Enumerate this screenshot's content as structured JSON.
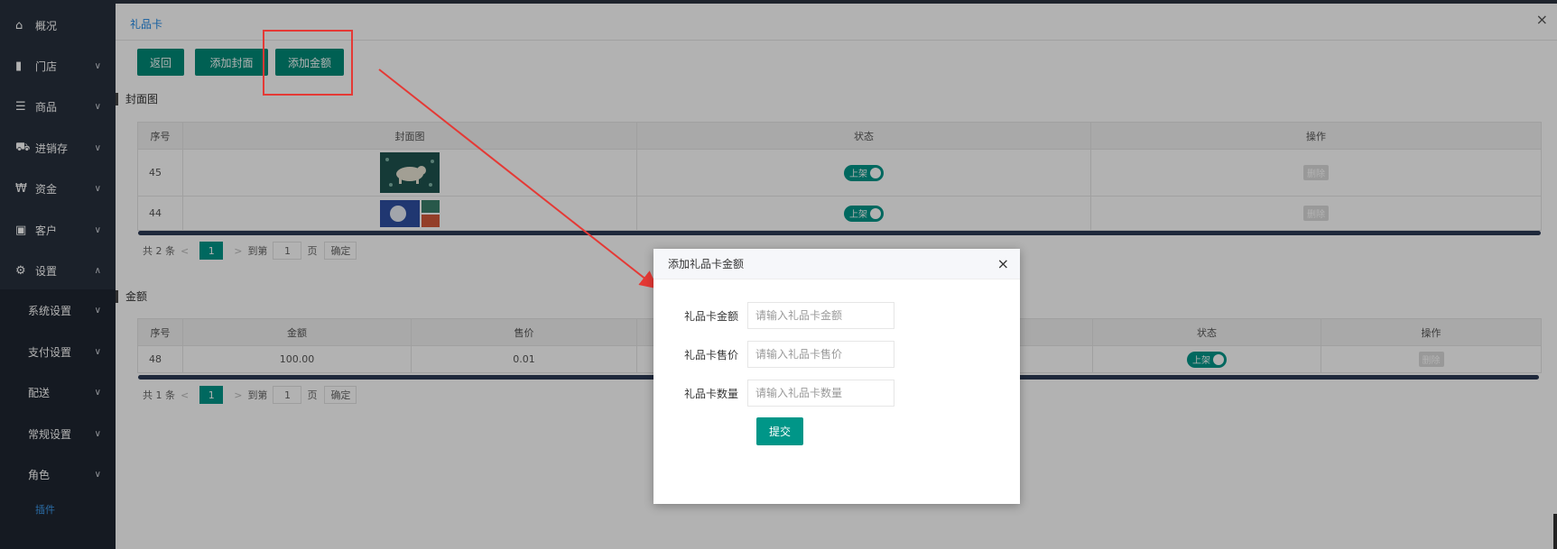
{
  "sidebar": {
    "items": [
      {
        "icon": "home-icon",
        "glyph": "⌂",
        "label": "概况",
        "chevron": ""
      },
      {
        "icon": "store-icon",
        "glyph": "▮",
        "label": "门店",
        "chevron": "∨"
      },
      {
        "icon": "list-icon",
        "glyph": "☰",
        "label": "商品",
        "chevron": "∨"
      },
      {
        "icon": "truck-icon",
        "glyph": "⛟",
        "label": "进销存",
        "chevron": "∨"
      },
      {
        "icon": "won-icon",
        "glyph": "₩",
        "label": "资金",
        "chevron": "∨"
      },
      {
        "icon": "id-card-icon",
        "glyph": "▣",
        "label": "客户",
        "chevron": "∨"
      },
      {
        "icon": "gear-icon",
        "glyph": "⚙",
        "label": "设置",
        "chevron": "∧"
      }
    ],
    "sub_items": [
      {
        "label": "系统设置",
        "chevron": "∨"
      },
      {
        "label": "支付设置",
        "chevron": "∨"
      },
      {
        "label": "配送",
        "chevron": "∨"
      },
      {
        "label": "常规设置",
        "chevron": "∨"
      },
      {
        "label": "角色",
        "chevron": "∨"
      }
    ],
    "active_leaf": "插件"
  },
  "tab": {
    "title": "礼品卡",
    "close": "×"
  },
  "toolbar": {
    "back": "返回",
    "add_cover": "添加封面",
    "add_amount": "添加金额"
  },
  "cover_section": {
    "title": "封面图",
    "headers": [
      "序号",
      "封面图",
      "状态",
      "操作"
    ],
    "rows": [
      {
        "id": "45",
        "status": "上架",
        "action": "删除"
      },
      {
        "id": "44",
        "status": "上架",
        "action": "删除"
      }
    ],
    "pager": {
      "total": "共 2 条",
      "prev": "<",
      "page": "1",
      "next": ">",
      "goto": "到第",
      "input": "1",
      "unit": "页",
      "confirm": "确定"
    }
  },
  "amount_section": {
    "title": "金额",
    "headers": [
      "序号",
      "金额",
      "售价",
      "状态",
      "操作"
    ],
    "rows": [
      {
        "id": "48",
        "amount": "100.00",
        "price": "0.01",
        "status": "上架",
        "action": "删除"
      }
    ],
    "pager": {
      "total": "共 1 条",
      "prev": "<",
      "page": "1",
      "next": ">",
      "goto": "到第",
      "input": "1",
      "unit": "页",
      "confirm": "确定"
    }
  },
  "modal": {
    "title": "添加礼品卡金额",
    "close": "×",
    "fields": [
      {
        "label": "礼品卡金额",
        "placeholder": "请输入礼品卡金额"
      },
      {
        "label": "礼品卡售价",
        "placeholder": "请输入礼品卡售价"
      },
      {
        "label": "礼品卡数量",
        "placeholder": "请输入礼品卡数量"
      }
    ],
    "submit": "提交"
  },
  "colors": {
    "accent": "#009688",
    "sidebar": "#28303d",
    "annotation": "#e53935"
  }
}
